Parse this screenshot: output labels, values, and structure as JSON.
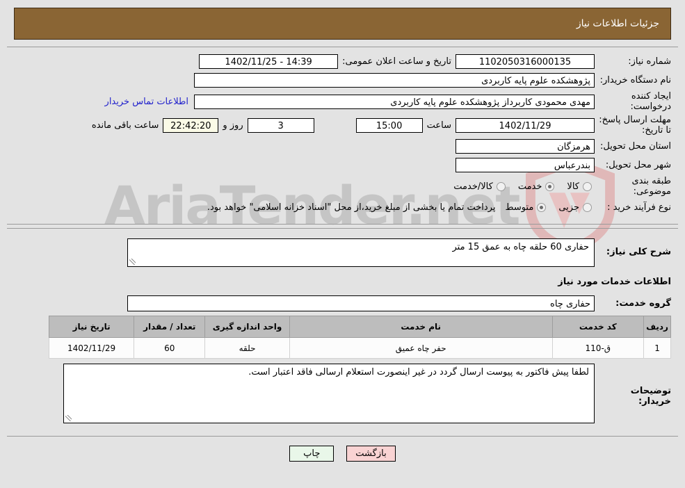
{
  "header": {
    "title": "جزئیات اطلاعات نیاز"
  },
  "watermark": {
    "text": "AriaTender.net",
    "logo_icon": "shield-icon",
    "color": "#828282",
    "logo_color": "#e3bcbc"
  },
  "details": {
    "need_number_label": "شماره نیاز:",
    "need_number_value": "1102050316000135",
    "announce_label": "تاریخ و ساعت اعلان عمومی:",
    "announce_value": "14:39 - 1402/11/25",
    "buyer_org_label": "نام دستگاه خریدار:",
    "buyer_org_value": "پژوهشکده علوم پایه کاربردی",
    "creator_label": "ایجاد کننده درخواست:",
    "creator_value": "مهدی محمودی کاربرداز پژوهشکده علوم پایه کاربردی",
    "contact_link": "اطلاعات تماس خریدار",
    "deadline_label": "مهلت ارسال پاسخ: تا تاریخ:",
    "deadline_date": "1402/11/29",
    "hour_label": "ساعت",
    "hour_value": "15:00",
    "days_value": "3",
    "days_and_label": "روز و",
    "countdown_value": "22:42:20",
    "remaining_label": "ساعت باقی مانده",
    "province_label": "استان محل تحویل:",
    "province_value": "هرمزگان",
    "city_label": "شهر محل تحویل:",
    "city_value": "بندرعباس",
    "category_label": "طبقه بندی موضوعی:",
    "category_options": [
      {
        "label": "کالا",
        "selected": false
      },
      {
        "label": "خدمت",
        "selected": true
      },
      {
        "label": "کالا/خدمت",
        "selected": false
      }
    ],
    "purchase_type_label": "نوع فرآیند خرید :",
    "purchase_type_options": [
      {
        "label": "جزیی",
        "selected": false
      },
      {
        "label": "متوسط",
        "selected": true
      }
    ],
    "purchase_note": "پرداخت تمام یا بخشی از مبلغ خرید،از محل \"اسناد خزانه اسلامی\" خواهد بود."
  },
  "description": {
    "general_label": "شرح کلی نیاز:",
    "general_value": "حفاری 60 حلقه چاه به عمق 15 متر",
    "services_section_title": "اطلاعات خدمات مورد نیاز",
    "service_group_label": "گروه خدمت:",
    "service_group_value": "حفاری چاه"
  },
  "items_table": {
    "columns": [
      "ردیف",
      "کد خدمت",
      "نام خدمت",
      "واحد اندازه گیری",
      "تعداد / مقدار",
      "تاریخ نیاز"
    ],
    "rows": [
      {
        "radif": "1",
        "code": "ق-110",
        "name": "حفر چاه عمیق",
        "unit": "حلقه",
        "qty": "60",
        "date": "1402/11/29"
      }
    ]
  },
  "buyer_notes": {
    "label": "توضیحات خریدار:",
    "value": "لطفا پیش فاکتور به پیوست ارسال گردد در غیر اینصورت استعلام ارسالی فاقد اعتبار است."
  },
  "footer": {
    "print_label": "چاپ",
    "back_label": "بازگشت"
  }
}
